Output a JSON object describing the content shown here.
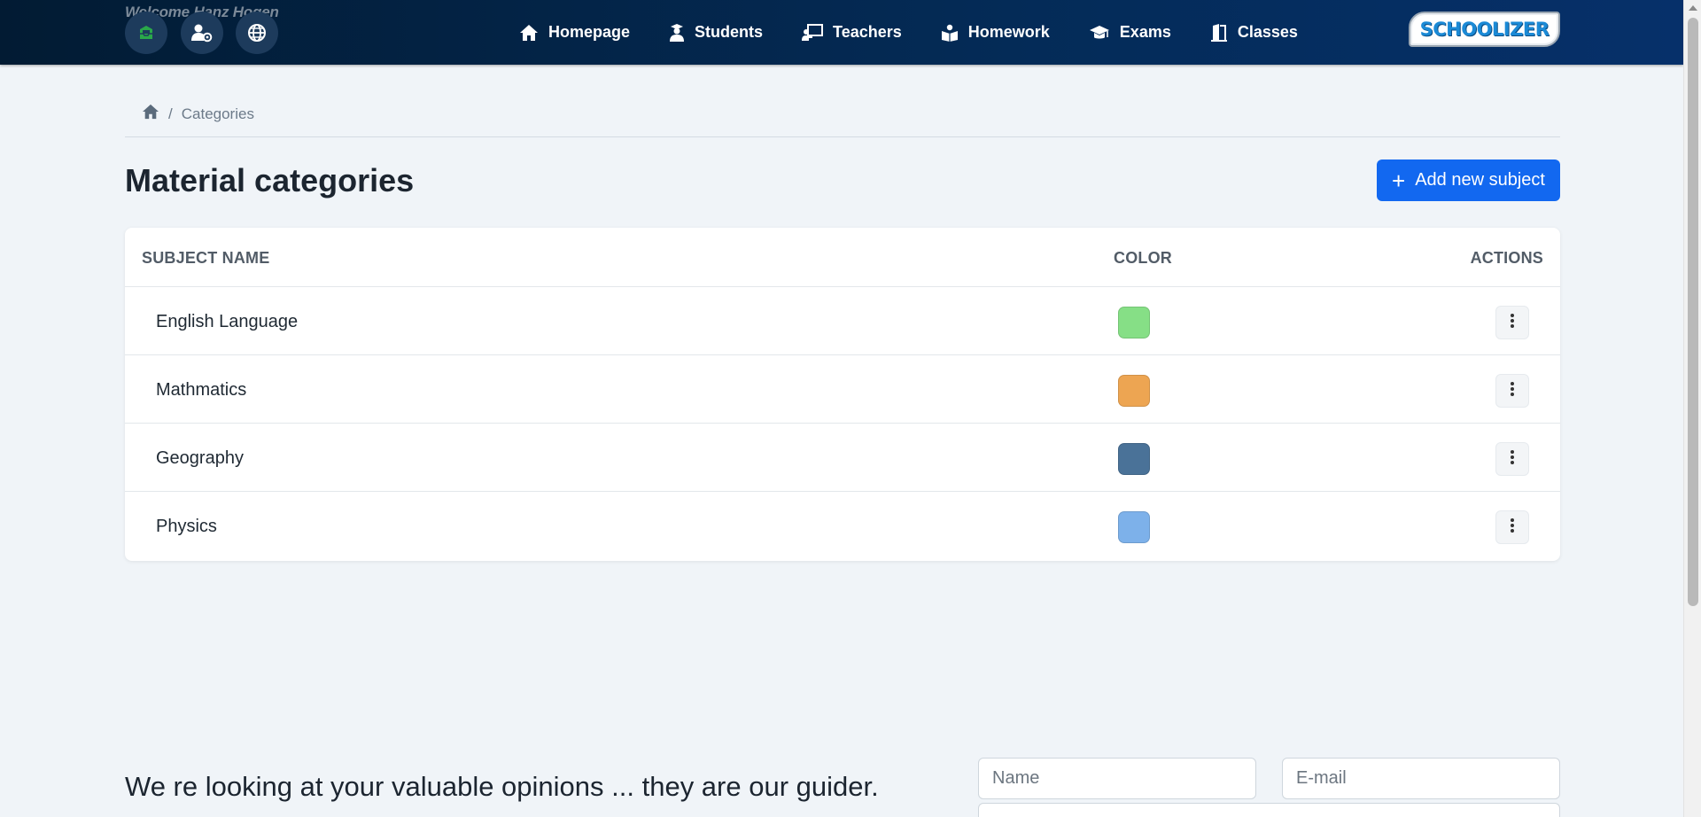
{
  "header": {
    "welcome": "Welcome Hanz Hogen",
    "circle_buttons": [
      {
        "icon": "inbox-icon",
        "color": "#2aa84a"
      },
      {
        "icon": "user-settings-icon",
        "color": "#ffffff"
      },
      {
        "icon": "globe-icon",
        "color": "#ffffff"
      }
    ],
    "nav": [
      {
        "label": "Homepage",
        "icon": "home-icon"
      },
      {
        "label": "Students",
        "icon": "graduate-icon"
      },
      {
        "label": "Teachers",
        "icon": "teacher-icon"
      },
      {
        "label": "Homework",
        "icon": "reading-icon"
      },
      {
        "label": "Exams",
        "icon": "graduation-cap-icon"
      },
      {
        "label": "Classes",
        "icon": "door-icon"
      }
    ],
    "logo_text": "SCHOOLIZER"
  },
  "breadcrumb": {
    "home_icon": "home-icon",
    "separator": "/",
    "current": "Categories"
  },
  "page": {
    "title": "Material categories",
    "add_button": "Add new subject"
  },
  "table": {
    "headers": {
      "name": "SUBJECT NAME",
      "color": "COLOR",
      "actions": "ACTIONS"
    },
    "rows": [
      {
        "name": "English Language",
        "color": "#86df86"
      },
      {
        "name": "Mathmatics",
        "color": "#eda552"
      },
      {
        "name": "Geography",
        "color": "#4a7298"
      },
      {
        "name": "Physics",
        "color": "#7db1ea"
      }
    ]
  },
  "feedback": {
    "text": "We re looking at your valuable opinions ... they are our guider.",
    "name_placeholder": "Name",
    "email_placeholder": "E-mail"
  },
  "colors": {
    "navbar": "#042b57",
    "primary": "#1268f0",
    "background": "#f0f4f8"
  }
}
